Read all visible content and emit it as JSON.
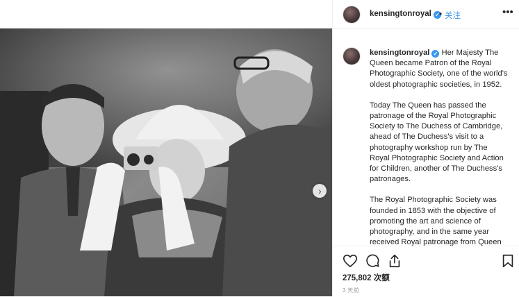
{
  "post": {
    "photo_description": "",
    "carousel_next_icon": "chevron-right-icon"
  },
  "header": {
    "username": "kensingtonroyal",
    "verified_icon": "verified-check-icon",
    "separator": "•",
    "follow_label": "关注",
    "more_icon": "more-horizontal-icon",
    "more_glyph": "•••"
  },
  "caption": {
    "username": "kensingtonroyal",
    "paragraphs": [
      "Her Majesty The Queen became Patron of the Royal Photographic Society, one of the world's oldest photographic societies, in 1952.",
      "Today The Queen has passed the patronage of the Royal Photographic Society to The Duchess of Cambridge, ahead of The Duchess's visit to a photography workshop run by The Royal Photographic Society and Action for Children, another of The Duchess's patronages.",
      "The Royal Photographic Society was founded in 1853 with the objective of promoting the art and science of photography, and in the same year received Royal patronage from Queen"
    ]
  },
  "actions": {
    "like_icon": "heart-icon",
    "comment_icon": "comment-icon",
    "share_icon": "share-icon",
    "save_icon": "bookmark-icon",
    "views": "275,802 次额",
    "time_ago": "3 天前"
  },
  "colors": {
    "accent_blue": "#3897f0",
    "text": "#262626",
    "muted": "#999999",
    "border": "#efefef"
  }
}
